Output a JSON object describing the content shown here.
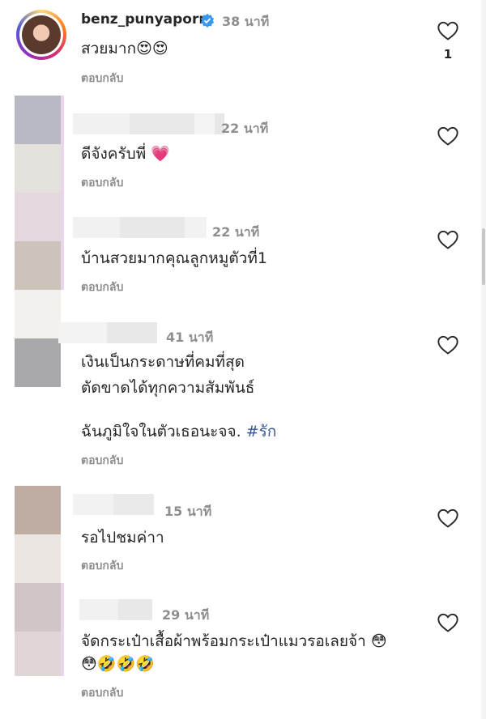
{
  "scrollbar": {
    "thumb_fraction": 0.08
  },
  "comments": [
    {
      "username": "benz_punyaporn",
      "verified": true,
      "time": "38 นาที",
      "text": "สวยมาก😍😍",
      "reply": "ตอบกลับ",
      "likes": "1"
    },
    {
      "time": "22 นาที",
      "text": "ดีจังครับพี่ 💗",
      "reply": "ตอบกลับ"
    },
    {
      "time": "22 นาที",
      "text": "บ้านสวยมากคุณลูกหมูตัวที่1",
      "reply": "ตอบกลับ"
    },
    {
      "time": "41 นาที",
      "text_line1": "เงินเป็นกระดาษที่คมที่สุด",
      "text_line2": "ตัดขาดได้ทุกความสัมพันธ์",
      "text_line3": "ฉันภูมิใจในตัวเธอนะจจ.",
      "hashtag": "#รัก",
      "reply": "ตอบกลับ"
    },
    {
      "time": "15 นาที",
      "text": "รอไปชมค่าา",
      "reply": "ตอบกลับ"
    },
    {
      "time": "29 นาที",
      "text_line1": "จัดกระเป๋าเสื้อผ้าพร้อมกระเป๋าแมวรอเลยจ้า 😳",
      "text_line2": "😳🤣🤣🤣",
      "reply": "ตอบกลับ"
    }
  ],
  "icons": {
    "heart": "heart-outline-icon",
    "verified": "verified-badge-icon"
  },
  "colors": {
    "muted": "#8e8e8e",
    "text": "#262626",
    "hashtag": "#385898",
    "verified": "#3897f0"
  }
}
